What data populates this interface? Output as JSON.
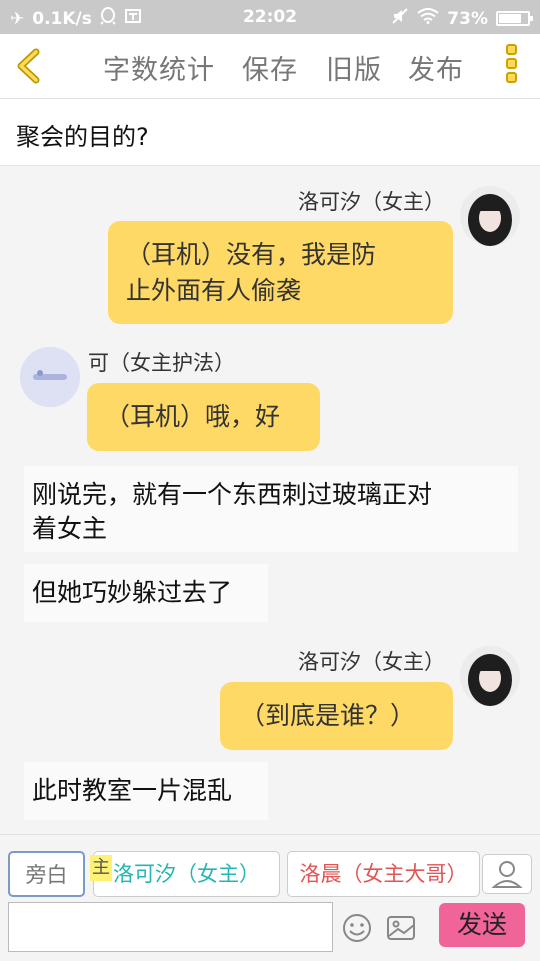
{
  "status_bar": {
    "net_speed": "0.1K/s",
    "time": "22:02",
    "battery": "73%",
    "battery_level": 0.73
  },
  "toolbar": {
    "word_count": "字数统计",
    "save": "保存",
    "old_version": "旧版",
    "publish": "发布"
  },
  "title": "聚会的目的?",
  "messages": [
    {
      "type": "role",
      "side": "right",
      "name": "洛可汐（女主）",
      "lines": [
        "（耳机）没有，我是防",
        "止外面有人偷袭"
      ]
    },
    {
      "type": "role",
      "side": "left",
      "name": "可（女主护法）",
      "lines": [
        "（耳机）哦，好"
      ]
    },
    {
      "type": "narration",
      "lines": [
        "刚说完，就有一个东西刺过玻璃正对",
        "着女主"
      ]
    },
    {
      "type": "narration",
      "lines": [
        "但她巧妙躲过去了"
      ]
    },
    {
      "type": "role",
      "side": "right",
      "name": "洛可汐（女主）",
      "lines": [
        "（到底是谁？）"
      ]
    },
    {
      "type": "narration",
      "lines": [
        "此时教室一片混乱"
      ]
    }
  ],
  "input_bar": {
    "roles": [
      "旁白",
      "洛可汐（女主）",
      "洛晨（女主大哥）"
    ],
    "main_badge": "主",
    "input_value": "",
    "send": "发送"
  },
  "icons": [
    "airplane-icon",
    "qq-icon",
    "screenshot-icon",
    "mute-icon",
    "wifi-icon",
    "battery-icon",
    "back-icon",
    "more-icon",
    "add-role-icon",
    "emoji-icon",
    "image-icon"
  ],
  "colors": {
    "bubble": "#ffd966",
    "send": "#f0649a",
    "accent": "#ffd95a",
    "teal_role": "#26b5b0",
    "red_role": "#e05555"
  }
}
